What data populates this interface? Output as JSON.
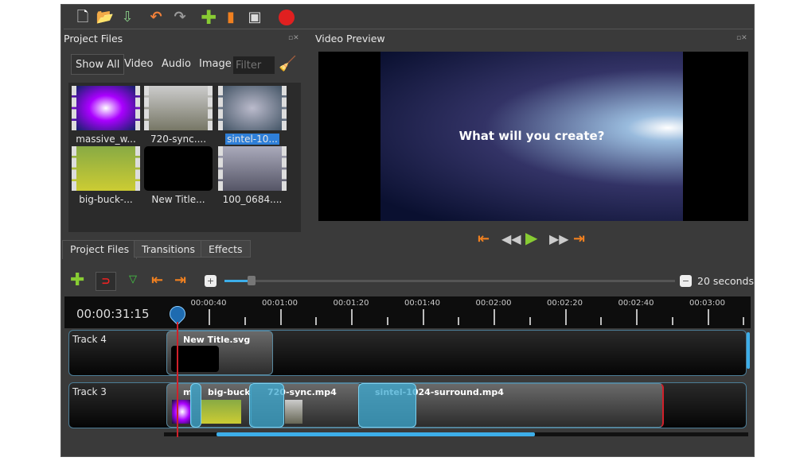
{
  "toolbar": {
    "icons": [
      "new-project-icon",
      "open-project-icon",
      "save-project-icon",
      "undo-icon",
      "redo-icon",
      "import-files-icon",
      "profile-icon",
      "fullscreen-icon",
      "export-video-icon"
    ]
  },
  "project_files": {
    "title": "Project Files",
    "filters": [
      "Show All",
      "Video",
      "Audio",
      "Image"
    ],
    "filter_placeholder": "Filter",
    "items": [
      "massive_w...",
      "720-sync....",
      "sintel-10...",
      "big-buck-...",
      "New Title...",
      "100_0684...."
    ],
    "selected": "sintel-10..."
  },
  "tabs": [
    "Project Files",
    "Transitions",
    "Effects"
  ],
  "preview": {
    "title": "Video Preview",
    "overlay_text": "What will you create?"
  },
  "timeline": {
    "zoom_label": "20 seconds",
    "zoom_fraction": 0.06,
    "timecode": "00:00:31:15",
    "ruler": [
      "00:00:40",
      "00:01:00",
      "00:01:20",
      "00:01:40",
      "00:02:00",
      "00:02:20",
      "00:02:40",
      "00:03:00"
    ],
    "tracks": [
      {
        "name": "Track 4",
        "clips": [
          "New Title.svg"
        ]
      },
      {
        "name": "Track 3",
        "clips": [
          "m",
          "big-buck-",
          "720-sync.mp4",
          "sintel-1024-surround.mp4"
        ]
      }
    ]
  },
  "colors": {
    "accent": "#3daee9",
    "playhead": "#d0202a",
    "selection": "#2f7fd8"
  }
}
